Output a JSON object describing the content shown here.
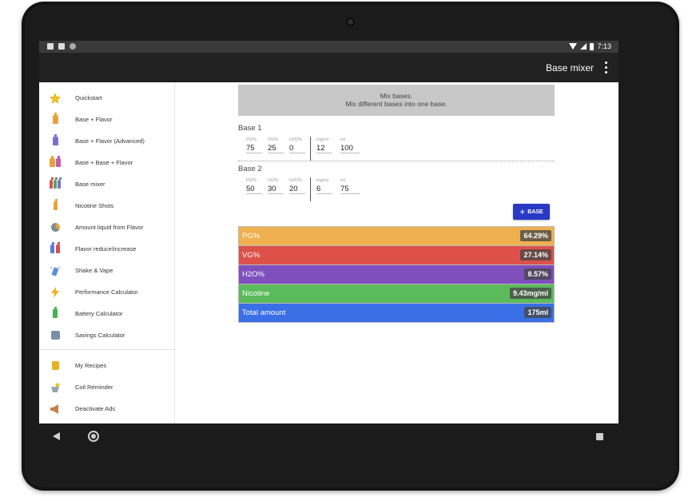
{
  "status_bar": {
    "time": "7:13"
  },
  "app_bar": {
    "title": "Base mixer",
    "menu_icon": "more-vert-icon"
  },
  "drawer": {
    "items": [
      {
        "label": "Quickstart",
        "icon": "star-icon"
      },
      {
        "label": "Base + Flavor",
        "icon": "bottle-icon"
      },
      {
        "label": "Base + Flavor (Advanced)",
        "icon": "bottle-advanced-icon"
      },
      {
        "label": "Base + Base + Flavor",
        "icon": "bottles-icon"
      },
      {
        "label": "Base mixer",
        "icon": "base-mixer-icon"
      },
      {
        "label": "Nicotine Shots",
        "icon": "nicotine-bottle-icon"
      },
      {
        "label": "Amount liquid from Flavor",
        "icon": "pie-chart-icon"
      },
      {
        "label": "Flavor reduce/increase",
        "icon": "scale-icon"
      },
      {
        "label": "Shake & Vape",
        "icon": "shake-icon"
      },
      {
        "label": "Performance Calculator",
        "icon": "lightning-icon"
      },
      {
        "label": "Battery Calculator",
        "icon": "battery-icon"
      },
      {
        "label": "Savings Calculator",
        "icon": "savings-icon"
      }
    ],
    "secondary_items": [
      {
        "label": "My Recipes",
        "icon": "recipe-book-icon"
      },
      {
        "label": "Coil Reminder",
        "icon": "coil-icon"
      },
      {
        "label": "Deactivate Ads",
        "icon": "megaphone-icon"
      }
    ]
  },
  "header": {
    "title": "Mix bases.",
    "subtitle": "Mix different bases into one base."
  },
  "bases": [
    {
      "label": "Base 1",
      "fields": [
        {
          "label": "PG%",
          "value": "75"
        },
        {
          "label": "VG%",
          "value": "25"
        },
        {
          "label": "H2O%",
          "value": "0"
        },
        {
          "label": "mg/ml",
          "value": "12"
        },
        {
          "label": "ml",
          "value": "100"
        }
      ]
    },
    {
      "label": "Base 2",
      "fields": [
        {
          "label": "PG%",
          "value": "50"
        },
        {
          "label": "VG%",
          "value": "30"
        },
        {
          "label": "H2O%",
          "value": "20"
        },
        {
          "label": "mg/ml",
          "value": "6"
        },
        {
          "label": "ml",
          "value": "75"
        }
      ]
    }
  ],
  "add_button": {
    "label": "BASE",
    "icon": "plus-icon"
  },
  "results": [
    {
      "label": "PG%",
      "value": "64.29%",
      "color": "#efb04f"
    },
    {
      "label": "VG%",
      "value": "27.14%",
      "color": "#de514b"
    },
    {
      "label": "H2O%",
      "value": "8.57%",
      "color": "#7e4fbd"
    },
    {
      "label": "Nicotine",
      "value": "9.43mg/ml",
      "color": "#5bba5b"
    },
    {
      "label": "Total amount",
      "value": "175ml",
      "color": "#3a6fe8"
    }
  ],
  "colors": {
    "app_bar": "#212121",
    "status_bar": "#3a3a3a",
    "accent": "#2a39c4",
    "header_box": "#c8c8c8"
  }
}
